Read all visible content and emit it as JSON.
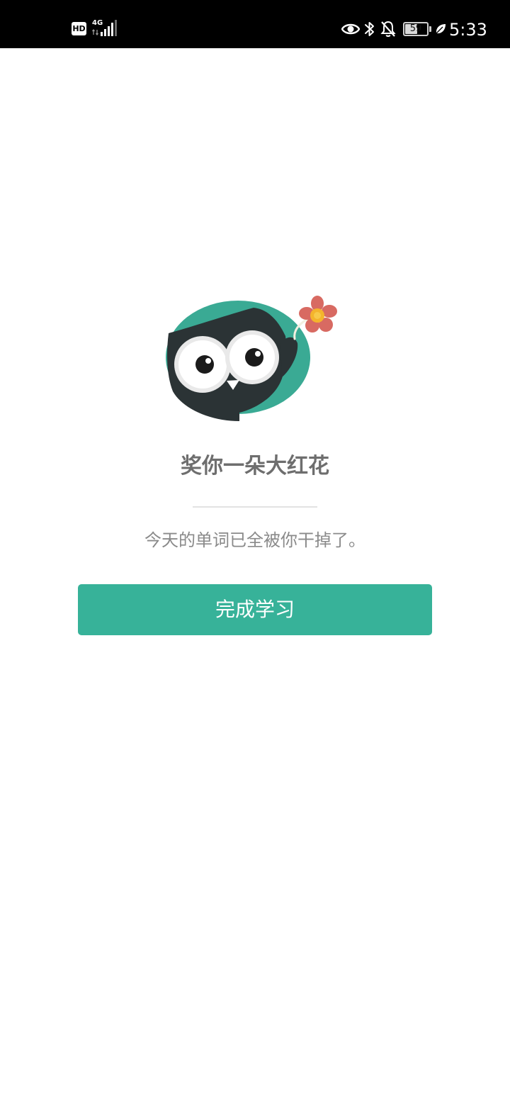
{
  "status_bar": {
    "hd_label": "HD",
    "network_label": "4G",
    "battery_level": "59",
    "battery_fraction": 0.59,
    "time": "5:33"
  },
  "main": {
    "title": "奖你一朵大红花",
    "message": "今天的单词已全被你干掉了。",
    "finish_button_label": "完成学习"
  },
  "colors": {
    "accent": "#37b299",
    "owl_background": "#3aaa94",
    "owl_body": "#2b3335",
    "flower_petals": "#d86a62",
    "flower_center": "#f4b42c"
  }
}
